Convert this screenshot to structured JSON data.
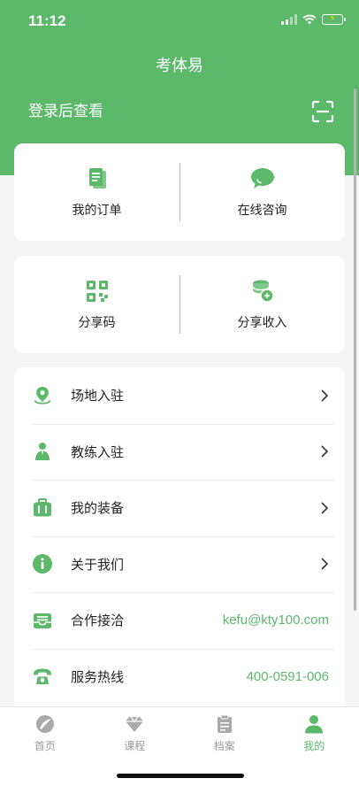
{
  "status": {
    "time": "11:12"
  },
  "header": {
    "title": "考体易",
    "login_text": "登录后查看",
    "scan_icon": "scan-icon"
  },
  "grid1": [
    {
      "label": "我的订单",
      "icon": "order-document-icon"
    },
    {
      "label": "在线咨询",
      "icon": "chat-bubble-icon"
    }
  ],
  "grid2": [
    {
      "label": "分享码",
      "icon": "qr-code-icon"
    },
    {
      "label": "分享收入",
      "icon": "coins-icon"
    }
  ],
  "list": [
    {
      "label": "场地入驻",
      "icon": "location-pin-icon",
      "value": ""
    },
    {
      "label": "教练入驻",
      "icon": "coach-person-icon",
      "value": ""
    },
    {
      "label": "我的装备",
      "icon": "equipment-bag-icon",
      "value": ""
    },
    {
      "label": "关于我们",
      "icon": "info-icon",
      "value": ""
    },
    {
      "label": "合作接洽",
      "icon": "mail-inbox-icon",
      "value": "kefu@kty100.com"
    },
    {
      "label": "服务热线",
      "icon": "telephone-icon",
      "value": "400-0591-006"
    }
  ],
  "tabs": [
    {
      "label": "首页",
      "icon": "home-icon",
      "active": false
    },
    {
      "label": "课程",
      "icon": "course-diamond-icon",
      "active": false
    },
    {
      "label": "档案",
      "icon": "archive-clipboard-icon",
      "active": false
    },
    {
      "label": "我的",
      "icon": "profile-person-icon",
      "active": true
    }
  ],
  "colors": {
    "brand_green": "#5cb86a",
    "tab_inactive": "#9b9b9b"
  }
}
